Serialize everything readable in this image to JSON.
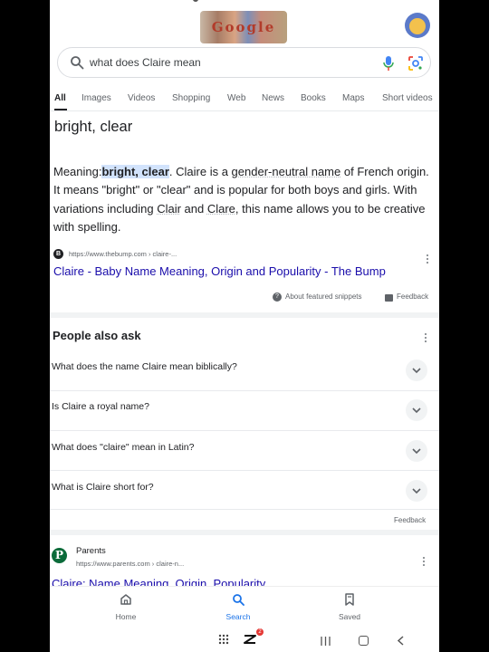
{
  "search": {
    "query": "what does Claire mean"
  },
  "doodle": {
    "text": "Google"
  },
  "tabs": [
    {
      "label": "All",
      "active": true
    },
    {
      "label": "Images"
    },
    {
      "label": "Videos"
    },
    {
      "label": "Shopping"
    },
    {
      "label": "Web"
    },
    {
      "label": "News"
    },
    {
      "label": "Books"
    },
    {
      "label": "Maps"
    },
    {
      "label": "Short videos"
    }
  ],
  "snippet": {
    "answer": "bright, clear",
    "prefix": "Meaning:",
    "highlight": "bright, clear",
    "mid": ". Claire is a ",
    "link1": "gender-neutral name",
    "mid2": " of French origin. It means \"bright\" or \"clear\" and is popular for both boys and girls. With variations including ",
    "link2": "Clair",
    "mid3": " and ",
    "link3": "Clare",
    "tail": ", this name allows you to be creative with spelling.",
    "source_favicon": "B",
    "source_url": "https://www.thebump.com › claire-...",
    "result_title": "Claire - Baby Name Meaning, Origin and Popularity - The Bump",
    "about_label": "About featured snippets",
    "feedback_label": "Feedback"
  },
  "paa": {
    "title": "People also ask",
    "questions": [
      "What does the name Claire mean biblically?",
      "Is Claire a royal name?",
      "What does \"claire\" mean in Latin?",
      "What is Claire short for?"
    ],
    "feedback_label": "Feedback"
  },
  "next_result": {
    "favicon": "P",
    "site": "Parents",
    "url": "https://www.parents.com › claire-n...",
    "title": "Claire: Name Meaning, Origin, Popularity"
  },
  "bottom_nav": [
    {
      "label": "Home",
      "icon": "home-icon"
    },
    {
      "label": "Search",
      "icon": "search-icon",
      "active": true
    },
    {
      "label": "Saved",
      "icon": "bookmark-icon"
    }
  ],
  "system_bar": {
    "notification_count": "2"
  },
  "colors": {
    "link": "#1a0dab",
    "accent": "#1a73e8",
    "highlight": "#d2e3fc"
  }
}
